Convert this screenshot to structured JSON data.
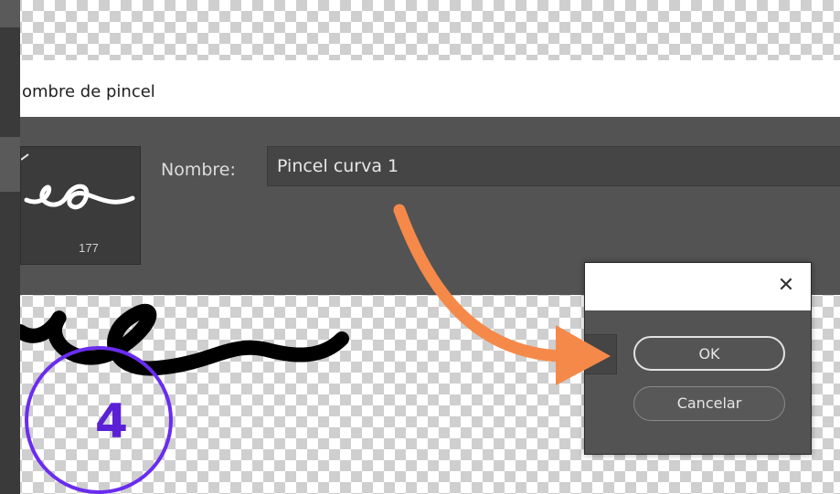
{
  "dialog": {
    "title": "ombre de pincel",
    "name_label": "Nombre:",
    "name_value": "Pincel curva 1",
    "brush_size": "177"
  },
  "mini_dialog": {
    "close_symbol": "✕",
    "ok_label": "OK",
    "cancel_label": "Cancelar"
  },
  "annotation": {
    "step_number": "4",
    "circle_color": "#6a2cf0",
    "arrow_color": "#f5894a"
  },
  "icons": [
    "close-icon",
    "brush-stroke-preview"
  ]
}
